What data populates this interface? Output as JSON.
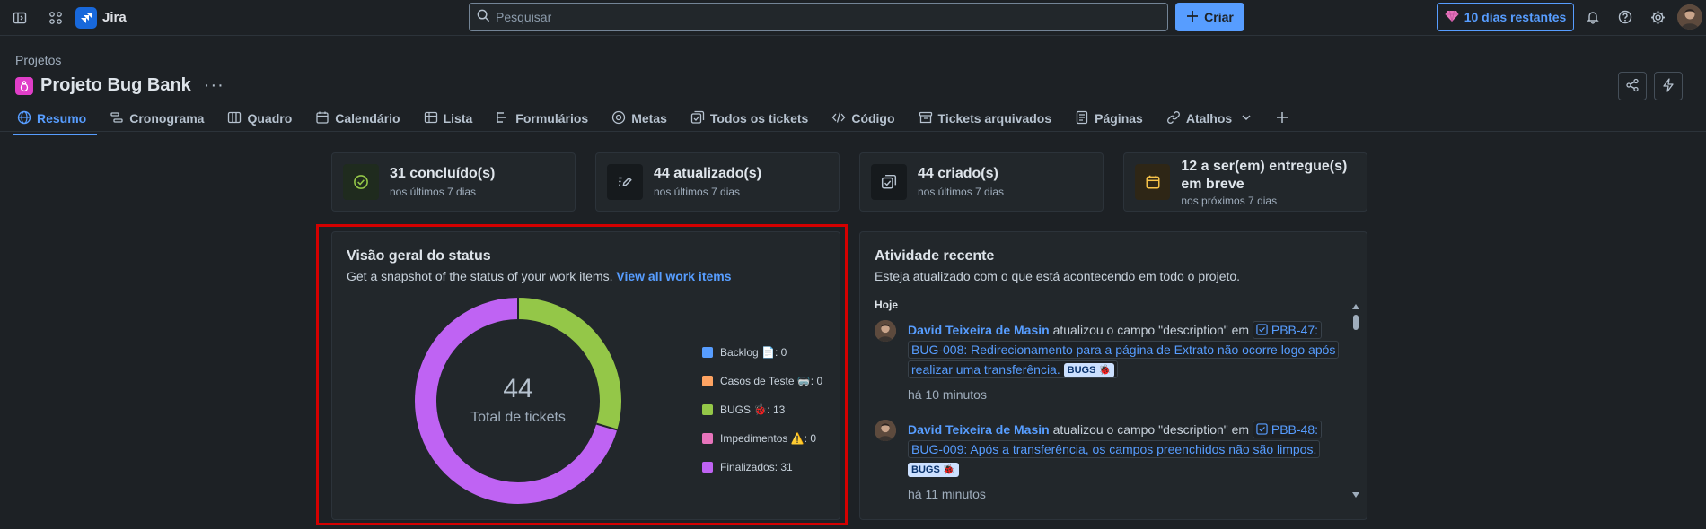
{
  "topbar": {
    "app_name": "Jira",
    "search_placeholder": "Pesquisar",
    "create_label": "Criar",
    "trial_label": "10 dias restantes"
  },
  "project": {
    "breadcrumb": "Projetos",
    "name": "Projeto Bug Bank",
    "more": "···"
  },
  "tabs": [
    {
      "label": "Resumo",
      "icon": "globe-icon"
    },
    {
      "label": "Cronograma",
      "icon": "timeline-icon"
    },
    {
      "label": "Quadro",
      "icon": "board-icon"
    },
    {
      "label": "Calendário",
      "icon": "calendar-icon"
    },
    {
      "label": "Lista",
      "icon": "list-icon"
    },
    {
      "label": "Formulários",
      "icon": "forms-icon"
    },
    {
      "label": "Metas",
      "icon": "goals-icon"
    },
    {
      "label": "Todos os tickets",
      "icon": "tickets-icon"
    },
    {
      "label": "Código",
      "icon": "code-icon"
    },
    {
      "label": "Tickets arquivados",
      "icon": "archive-icon"
    },
    {
      "label": "Páginas",
      "icon": "pages-icon"
    },
    {
      "label": "Atalhos",
      "icon": "link-icon"
    }
  ],
  "stats": [
    {
      "title": "31 concluído(s)",
      "sub": "nos últimos 7 dias",
      "icon": "check-circle-icon",
      "color": "#94c748"
    },
    {
      "title": "44 atualizado(s)",
      "sub": "nos últimos 7 dias",
      "icon": "edit-icon",
      "color": "#b6c2cf"
    },
    {
      "title": "44 criado(s)",
      "sub": "nos últimos 7 dias",
      "icon": "create-icon",
      "color": "#b6c2cf"
    },
    {
      "title": "12 a ser(em) entregue(s) em breve",
      "sub": "nos próximos 7 dias",
      "icon": "calendar-icon",
      "color": "#f8c44a"
    }
  ],
  "status": {
    "title": "Visão geral do status",
    "subtitle": "Get a snapshot of the status of your work items.",
    "link": "View all work items",
    "total_value": "44",
    "total_label": "Total de tickets"
  },
  "chart_data": {
    "type": "pie",
    "total": 44,
    "categories": [
      "Backlog 📄",
      "Casos de Teste 🥽",
      "BUGS 🐞",
      "Impedimentos ⚠️",
      "Finalizados"
    ],
    "values": [
      0,
      0,
      13,
      0,
      31
    ],
    "colors": [
      "#579dff",
      "#fea362",
      "#94c748",
      "#e774bb",
      "#bf63f3"
    ],
    "legend_labels": [
      "Backlog 📄: 0",
      "Casos de Teste 🥽: 0",
      "BUGS 🐞: 13",
      "Impedimentos ⚠️: 0",
      "Finalizados: 31"
    ]
  },
  "activity": {
    "title": "Atividade recente",
    "subtitle": "Esteja atualizado com o que está acontecendo em todo o projeto.",
    "group": "Hoje",
    "items": [
      {
        "user": "David Teixeira de Masin",
        "action": "atualizou o campo \"description\" em",
        "ticket": "PBB-47: BUG-008: Redirecionamento para a página de Extrato não ocorre logo após realizar uma transferência.",
        "badge": "BUGS 🐞",
        "time": "há 10 minutos"
      },
      {
        "user": "David Teixeira de Masin",
        "action": "atualizou o campo \"description\" em",
        "ticket": "PBB-48: BUG-009: Após a transferência, os campos preenchidos não são limpos.",
        "badge": "BUGS 🐞",
        "time": "há 11 minutos"
      }
    ]
  }
}
